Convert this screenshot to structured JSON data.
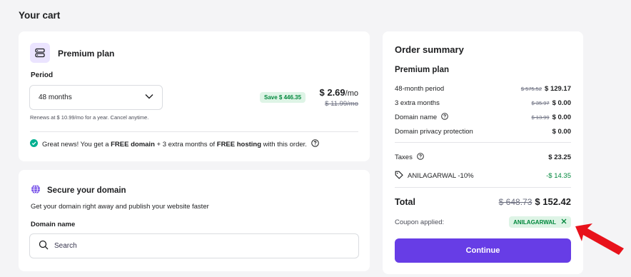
{
  "page_title": "Your cart",
  "plan": {
    "title": "Premium plan",
    "period_label": "Period",
    "period_value": "48 months",
    "save_badge": "Save $ 446.35",
    "price_now": "$ 2.69",
    "price_unit": "/mo",
    "price_old": "$ 11.99/mo",
    "renews": "Renews at $ 10.99/mo for a year. Cancel anytime.",
    "news": {
      "prefix": "Great news! You get a ",
      "bold1": "FREE domain",
      "mid": " + 3 extra months of ",
      "bold2": "FREE hosting",
      "suffix": " with this order."
    }
  },
  "domain": {
    "title": "Secure your domain",
    "subtitle": "Get your domain right away and publish your website faster",
    "label": "Domain name",
    "search_placeholder": "Search"
  },
  "summary": {
    "title": "Order summary",
    "plan_name": "Premium plan",
    "rows": [
      {
        "label": "48-month period",
        "old": "$ 575.52",
        "value": "$ 129.17"
      },
      {
        "label": "3 extra months",
        "old": "$ 35.97",
        "value": "$ 0.00"
      },
      {
        "label": "Domain name",
        "old": "$ 13.99",
        "value": "$ 0.00"
      },
      {
        "label": "Domain privacy protection",
        "old": "",
        "value": "$ 0.00"
      }
    ],
    "taxes_label": "Taxes",
    "taxes_value": "$ 23.25",
    "discount_label": "ANILAGARWAL -10%",
    "discount_value": "-$ 14.35",
    "total_label": "Total",
    "total_old": "$ 648.73",
    "total_now": "$ 152.42",
    "coupon_label": "Coupon applied:",
    "coupon_code": "ANILAGARWAL",
    "continue_label": "Continue"
  },
  "colors": {
    "accent": "#673de6",
    "success": "#00873c",
    "success_bg": "#def4e6",
    "annotation_arrow": "#e8121b"
  }
}
